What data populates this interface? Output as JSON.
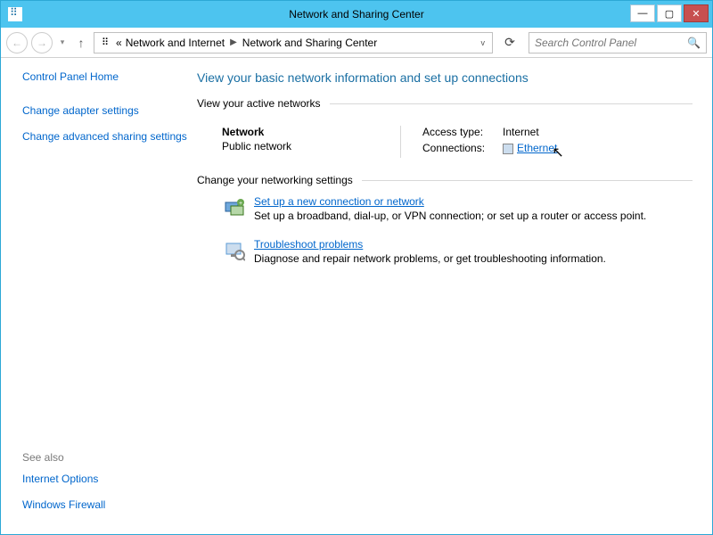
{
  "window": {
    "title": "Network and Sharing Center"
  },
  "toolbar": {
    "breadcrumb": {
      "prefix": "«",
      "parent": "Network and Internet",
      "current": "Network and Sharing Center"
    },
    "search_placeholder": "Search Control Panel"
  },
  "sidebar": {
    "home": "Control Panel Home",
    "links": [
      "Change adapter settings",
      "Change advanced sharing settings"
    ],
    "seealso_label": "See also",
    "seealso": [
      "Internet Options",
      "Windows Firewall"
    ]
  },
  "main": {
    "heading": "View your basic network information and set up connections",
    "active_label": "View your active networks",
    "network": {
      "name": "Network",
      "type": "Public network",
      "access_label": "Access type:",
      "access_value": "Internet",
      "conn_label": "Connections:",
      "conn_value": "Ethernet"
    },
    "change_label": "Change your networking settings",
    "items": [
      {
        "title": "Set up a new connection or network",
        "desc": "Set up a broadband, dial-up, or VPN connection; or set up a router or access point."
      },
      {
        "title": "Troubleshoot problems",
        "desc": "Diagnose and repair network problems, or get troubleshooting information."
      }
    ]
  }
}
